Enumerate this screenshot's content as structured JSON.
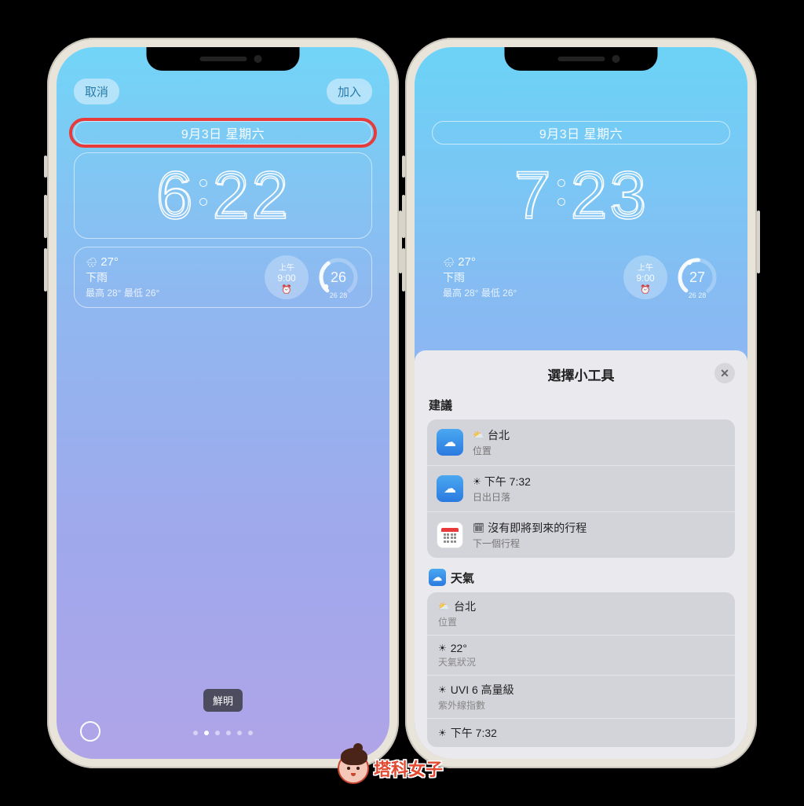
{
  "left": {
    "cancel": "取消",
    "add": "加入",
    "date": "9月3日 星期六",
    "time_digits": [
      "6",
      "2",
      "2"
    ],
    "weather": {
      "temp": "27°",
      "cond": "下雨",
      "hilo": "最高 28° 最低 26°"
    },
    "alarm": {
      "ampm": "上午",
      "time": "9:00"
    },
    "ring": {
      "value": "26",
      "range": "26  28"
    },
    "style_label": "鮮明",
    "page_dots": {
      "count": 6,
      "active": 1
    }
  },
  "right": {
    "date": "9月3日 星期六",
    "time_digits": [
      "7",
      "2",
      "3"
    ],
    "weather": {
      "temp": "27°",
      "cond": "下雨",
      "hilo": "最高 28° 最低 26°"
    },
    "alarm": {
      "ampm": "上午",
      "time": "9:00"
    },
    "ring": {
      "value": "27",
      "range": "26  28"
    },
    "sheet": {
      "title": "選擇小工具",
      "section_suggest": "建議",
      "suggestions": [
        {
          "icon": "weather",
          "glyph": "⛅",
          "title": "台北",
          "sub": "位置"
        },
        {
          "icon": "weather",
          "glyph": "☀",
          "title": "下午 7:32",
          "sub": "日出日落"
        },
        {
          "icon": "calendar",
          "glyph": "🗓",
          "title": "沒有即將到來的行程",
          "sub": "下一個行程"
        }
      ],
      "section_weather": "天氣",
      "weather_items": [
        {
          "glyph": "⛅",
          "title": "台北",
          "sub": "位置"
        },
        {
          "glyph": "☀",
          "title": "22°",
          "sub": "天氣狀況"
        },
        {
          "glyph": "☀",
          "title": "UVI 6 高量級",
          "sub": "紫外線指數"
        },
        {
          "glyph": "☀",
          "title": "下午 7:32",
          "sub": ""
        }
      ]
    }
  },
  "watermark": "塔科女子"
}
